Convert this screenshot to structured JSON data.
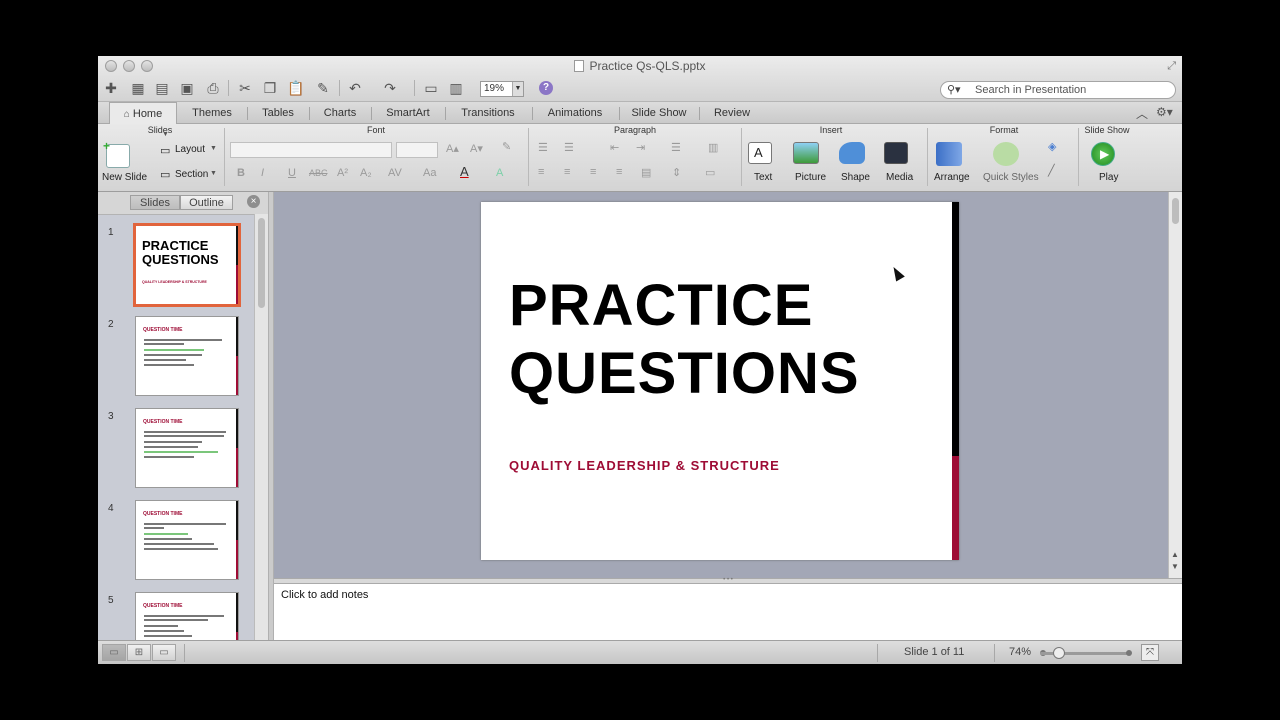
{
  "window": {
    "title": "Practice Qs-QLS.pptx"
  },
  "toolbar": {
    "zoom_value": "19%",
    "help_label": "?",
    "search_placeholder": "Search in Presentation"
  },
  "tabs": [
    {
      "label": "Home",
      "active": true
    },
    {
      "label": "Themes"
    },
    {
      "label": "Tables"
    },
    {
      "label": "Charts"
    },
    {
      "label": "SmartArt"
    },
    {
      "label": "Transitions"
    },
    {
      "label": "Animations"
    },
    {
      "label": "Slide Show"
    },
    {
      "label": "Review"
    }
  ],
  "ribbon": {
    "groups": {
      "slides": "Slides",
      "font": "Font",
      "paragraph": "Paragraph",
      "insert": "Insert",
      "format": "Format",
      "slide_show": "Slide Show"
    },
    "new_slide": "New Slide",
    "layout": "Layout",
    "section": "Section",
    "text": "Text",
    "picture": "Picture",
    "shape": "Shape",
    "media": "Media",
    "arrange": "Arrange",
    "quick_styles": "Quick Styles",
    "play": "Play"
  },
  "sidebar": {
    "view_tabs": [
      {
        "label": "Slides",
        "active": true
      },
      {
        "label": "Outline"
      }
    ],
    "close_label": "×",
    "slides": [
      {
        "number": "1",
        "kind": "title",
        "title_line1": "PRACTICE",
        "title_line2": "QUESTIONS",
        "subtitle": "QUALITY LEADERSHIP & STRUCTURE",
        "selected": true
      },
      {
        "number": "2",
        "kind": "question",
        "heading": "QUESTION TIME"
      },
      {
        "number": "3",
        "kind": "question",
        "heading": "QUESTION TIME"
      },
      {
        "number": "4",
        "kind": "question",
        "heading": "QUESTION TIME"
      },
      {
        "number": "5",
        "kind": "question",
        "heading": "QUESTION TIME"
      }
    ]
  },
  "slide": {
    "title_line1": "PRACTICE",
    "title_line2": "QUESTIONS",
    "subtitle": "QUALITY LEADERSHIP & STRUCTURE",
    "accent_color": "#9e0c35"
  },
  "notes": {
    "placeholder": "Click to add notes"
  },
  "status": {
    "slide_position": "Slide 1 of 11",
    "zoom": "74%"
  }
}
